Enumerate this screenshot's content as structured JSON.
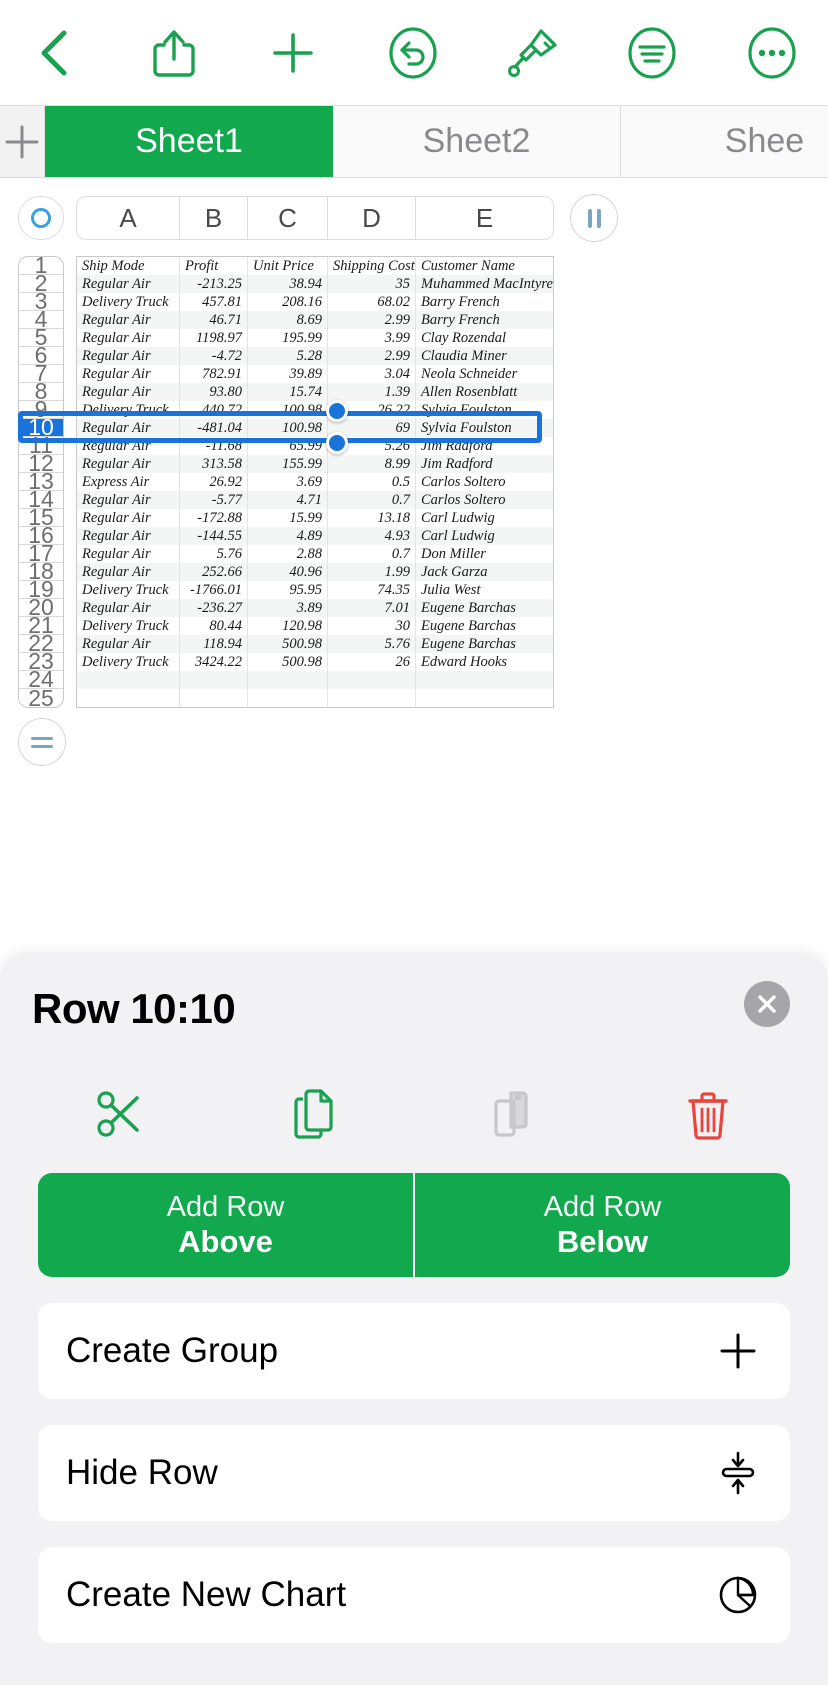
{
  "toolbar": {
    "buttons": [
      {
        "name": "back-icon",
        "label": "Back"
      },
      {
        "name": "share-icon",
        "label": "Share"
      },
      {
        "name": "plus-icon",
        "label": "Insert"
      },
      {
        "name": "undo-icon",
        "label": "Undo"
      },
      {
        "name": "paintbrush-icon",
        "label": "Format"
      },
      {
        "name": "align-icon",
        "label": "View Options"
      },
      {
        "name": "more-icon",
        "label": "More"
      }
    ]
  },
  "tabs": {
    "add_label": "+",
    "items": [
      {
        "label": "Sheet1",
        "active": true
      },
      {
        "label": "Sheet2",
        "active": false
      },
      {
        "label": "Shee",
        "active": false
      }
    ]
  },
  "grid": {
    "columns": [
      "A",
      "B",
      "C",
      "D",
      "E"
    ],
    "headers": [
      "Ship Mode",
      "Profit",
      "Unit Price",
      "Shipping Cost",
      "Customer Name"
    ],
    "row_numbers": [
      "1",
      "2",
      "3",
      "4",
      "5",
      "6",
      "7",
      "8",
      "9",
      "10",
      "11",
      "12",
      "13",
      "14",
      "15",
      "16",
      "17",
      "18",
      "19",
      "20",
      "21",
      "22",
      "23",
      "24",
      "25"
    ],
    "selected_row": "10",
    "rows": [
      [
        "Ship Mode",
        "Profit",
        "Unit Price",
        "Shipping Cost",
        "Customer Name"
      ],
      [
        "Regular Air",
        "-213.25",
        "38.94",
        "35",
        "Muhammed MacIntyre"
      ],
      [
        "Delivery Truck",
        "457.81",
        "208.16",
        "68.02",
        "Barry French"
      ],
      [
        "Regular Air",
        "46.71",
        "8.69",
        "2.99",
        "Barry French"
      ],
      [
        "Regular Air",
        "1198.97",
        "195.99",
        "3.99",
        "Clay Rozendal"
      ],
      [
        "Regular Air",
        "-4.72",
        "5.28",
        "2.99",
        "Claudia Miner"
      ],
      [
        "Regular Air",
        "782.91",
        "39.89",
        "3.04",
        "Neola Schneider"
      ],
      [
        "Regular Air",
        "93.80",
        "15.74",
        "1.39",
        "Allen Rosenblatt"
      ],
      [
        "Delivery Truck",
        "440.72",
        "100.98",
        "26.22",
        "Sylvia Foulston"
      ],
      [
        "Regular Air",
        "-481.04",
        "100.98",
        "69",
        "Sylvia Foulston"
      ],
      [
        "Regular Air",
        "-11.68",
        "65.99",
        "5.26",
        "Jim Radford"
      ],
      [
        "Regular Air",
        "313.58",
        "155.99",
        "8.99",
        "Jim Radford"
      ],
      [
        "Express Air",
        "26.92",
        "3.69",
        "0.5",
        "Carlos Soltero"
      ],
      [
        "Regular Air",
        "-5.77",
        "4.71",
        "0.7",
        "Carlos Soltero"
      ],
      [
        "Regular Air",
        "-172.88",
        "15.99",
        "13.18",
        "Carl Ludwig"
      ],
      [
        "Regular Air",
        "-144.55",
        "4.89",
        "4.93",
        "Carl Ludwig"
      ],
      [
        "Regular Air",
        "5.76",
        "2.88",
        "0.7",
        "Don Miller"
      ],
      [
        "Regular Air",
        "252.66",
        "40.96",
        "1.99",
        "Jack Garza"
      ],
      [
        "Delivery Truck",
        "-1766.01",
        "95.95",
        "74.35",
        "Julia West"
      ],
      [
        "Regular Air",
        "-236.27",
        "3.89",
        "7.01",
        "Eugene Barchas"
      ],
      [
        "Delivery Truck",
        "80.44",
        "120.98",
        "30",
        "Eugene Barchas"
      ],
      [
        "Regular Air",
        "118.94",
        "500.98",
        "5.76",
        "Eugene Barchas"
      ],
      [
        "Delivery Truck",
        "3424.22",
        "500.98",
        "26",
        "Edward Hooks"
      ],
      [
        "",
        "",
        "",
        "",
        ""
      ],
      [
        "",
        "",
        "",
        "",
        ""
      ]
    ]
  },
  "panel": {
    "title": "Row 10:10",
    "close_label": "×",
    "quick_actions": [
      {
        "name": "cut-icon",
        "label": "Cut",
        "enabled": true
      },
      {
        "name": "copy-icon",
        "label": "Copy",
        "enabled": true
      },
      {
        "name": "paste-icon",
        "label": "Paste",
        "enabled": false
      },
      {
        "name": "delete-icon",
        "label": "Delete",
        "enabled": true
      }
    ],
    "add_row_above": {
      "line1": "Add Row",
      "line2": "Above"
    },
    "add_row_below": {
      "line1": "Add Row",
      "line2": "Below"
    },
    "menu_items": [
      {
        "label": "Create Group",
        "icon": "plus-icon"
      },
      {
        "label": "Hide Row",
        "icon": "collapse-rows-icon"
      },
      {
        "label": "Create New Chart",
        "icon": "pie-chart-icon"
      }
    ]
  },
  "colors": {
    "brand_green": "#12a84e",
    "selection_blue": "#1a73d9",
    "delete_red": "#e8453c",
    "disabled_gray": "#c7c7cc"
  }
}
